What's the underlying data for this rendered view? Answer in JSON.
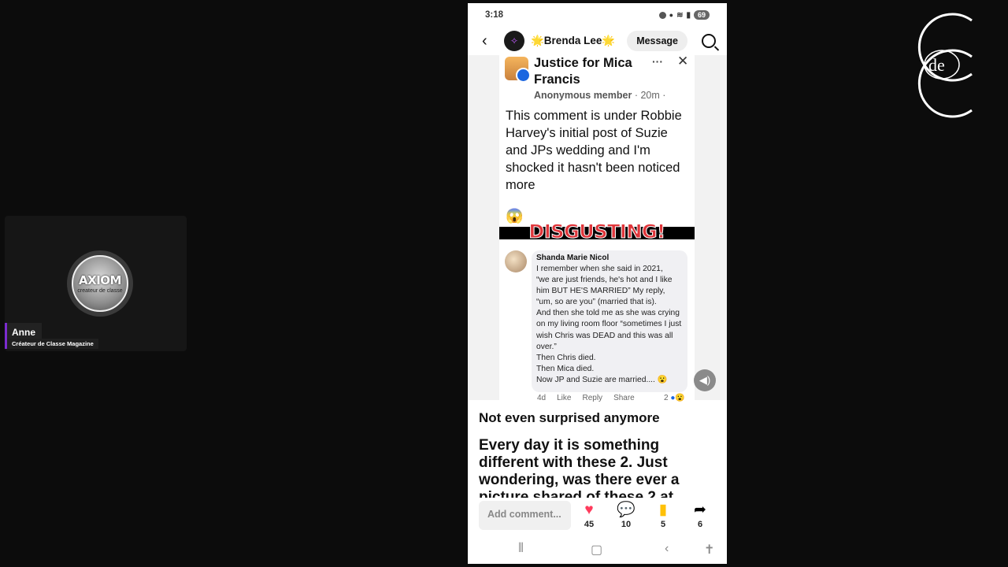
{
  "participant": {
    "logo_text": "AXIOM",
    "logo_subtext": "createur de classe",
    "name": "Anne",
    "subtitle": "Créateur de Classe Magazine"
  },
  "corner_logo": {
    "text": "de"
  },
  "phone": {
    "status": {
      "time": "3:18",
      "battery": "69"
    },
    "topbar": {
      "profile_name": "🌟Brenda Lee🌟",
      "message_label": "Message"
    },
    "embedded_post": {
      "group_title": "Justice for Mica Francis",
      "author": "Anonymous member",
      "time": "· 20m ·",
      "text": "This comment is under Robbie Harvey's initial post of Suzie and JPs wedding and I'm shocked it hasn't been noticed more",
      "emoji": "😱",
      "banner": "DISGUSTING!",
      "comment": {
        "author": "Shanda Marie Nicol",
        "body": "I remember when she said in 2021,\n“we are just friends, he's hot and I like him BUT HE'S MARRIED” My reply, “um, so are you” (married that is).\nAnd then she told me as she was crying on my living room floor “sometimes I just wish Chris was DEAD and this was all over.”\nThen Chris died.\nThen Mica died.\nNow JP and Suzie are married.... 😮",
        "age": "4d",
        "like": "Like",
        "reply": "Reply",
        "share": "Share",
        "reactions": "2"
      }
    },
    "post": {
      "title": "Not even surprised anymore",
      "body": "Every day it is something different with these 2. Just wondering, was there ever a picture shared of these 2 at"
    },
    "actions": {
      "add_comment_placeholder": "Add comment...",
      "likes": "45",
      "comments": "10",
      "saves": "5",
      "shares": "6"
    },
    "colors": {
      "like": "#ff3b5c",
      "save": "#ffc107"
    }
  }
}
